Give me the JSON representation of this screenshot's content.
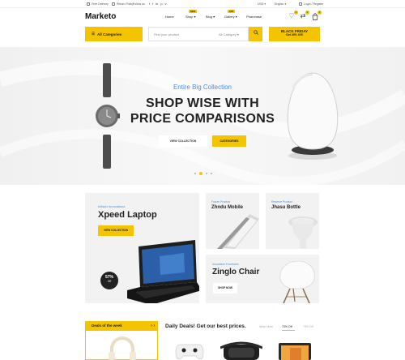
{
  "topbar": {
    "free_delivery": "Free Delivery",
    "return_policy": "Return Policy",
    "follow_us": "Follow us",
    "social": [
      "f",
      "t",
      "in",
      "p",
      "v"
    ],
    "currency": "USD",
    "language": "English",
    "login": "Login / Register"
  },
  "header": {
    "logo": "Marketo",
    "nav": [
      {
        "label": "Home",
        "badge": ""
      },
      {
        "label": "Shop",
        "badge": "NEW"
      },
      {
        "label": "Blog",
        "badge": ""
      },
      {
        "label": "Gallery",
        "badge": "HOT"
      },
      {
        "label": "Pharchase",
        "badge": ""
      }
    ],
    "wishlist_count": "0",
    "compare_count": "0",
    "cart_count": "0"
  },
  "search": {
    "categories_label": "All Categories",
    "placeholder": "Find your product",
    "category_select": "All Category",
    "promo_title": "BLACK FRIDAY",
    "promo_sub": "Get 45% Off!"
  },
  "hero": {
    "subtitle": "Entire Big Collection",
    "title_line1": "SHOP WISE WITH",
    "title_line2": "PRICE COMPARISONS",
    "btn_collection": "VIEW COLLECTION",
    "btn_categories": "CATEGORIES",
    "slides": 4,
    "active_slide": 2
  },
  "banners": {
    "laptop": {
      "label": "Infiach Innovations",
      "title": "Xpeed Laptop",
      "btn": "VIEW COLLECTION",
      "discount": "57%",
      "discount_sub": "Off"
    },
    "phone": {
      "label": "Future Product",
      "title": "Zhndu Mobile"
    },
    "bottle": {
      "label": "Reserve Product",
      "title": "Jhasu Bottle"
    },
    "chair": {
      "label": "Innovative Furnitures",
      "title": "Zinglo Chair",
      "btn": "SHOP NOW"
    }
  },
  "deals": {
    "week_title": "Deals of the week",
    "daily_title": "Daily Deals! Get our best prices.",
    "tabs": [
      "Wide Urea",
      "70% Off",
      "70% Off"
    ],
    "active_tab": 1
  },
  "colors": {
    "accent": "#f5c400",
    "link_blue": "#4a8fd8"
  }
}
